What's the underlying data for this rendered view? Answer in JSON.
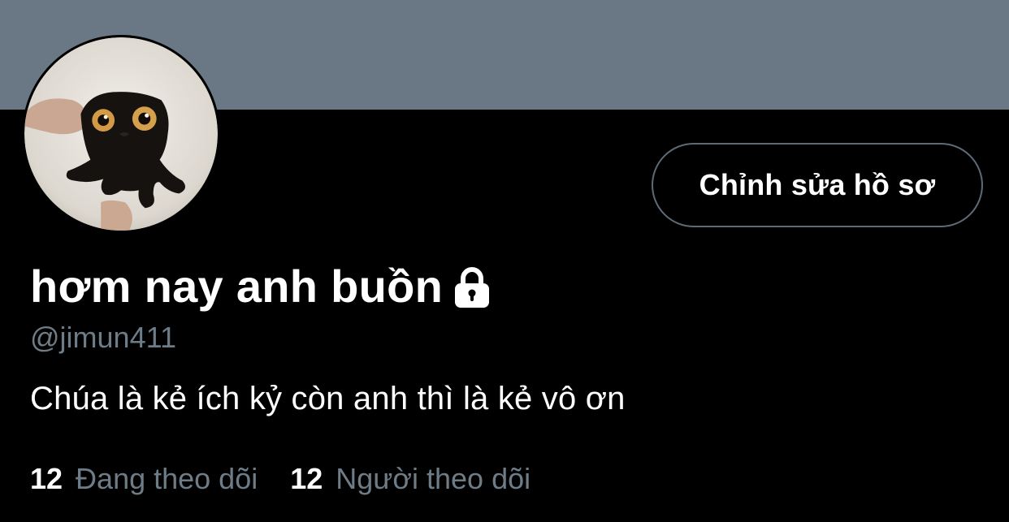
{
  "profile": {
    "display_name": "hơm nay anh buồn",
    "handle": "@jimun411",
    "bio": "Chúa là kẻ ích kỷ còn anh thì là kẻ vô ơn",
    "protected": true
  },
  "actions": {
    "edit_profile_label": "Chỉnh sửa hồ sơ"
  },
  "stats": {
    "following_count": "12",
    "following_label": "Đang theo dõi",
    "followers_count": "12",
    "followers_label": "Người theo dõi"
  },
  "colors": {
    "background": "#000000",
    "banner": "#6a7885",
    "muted_text": "#6e7c87",
    "button_border": "#5e6b77",
    "primary_text": "#ffffff"
  },
  "icons": {
    "lock": "lock-icon"
  }
}
